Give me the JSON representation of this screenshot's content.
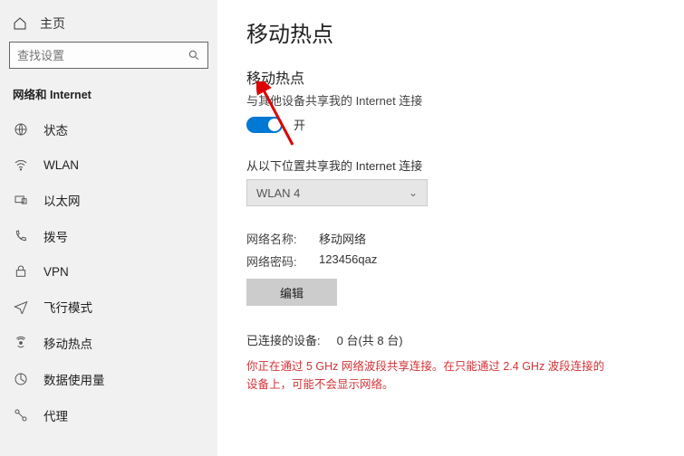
{
  "sidebar": {
    "home_label": "主页",
    "search_placeholder": "查找设置",
    "section_title": "网络和 Internet",
    "items": [
      {
        "label": "状态",
        "icon": "status"
      },
      {
        "label": "WLAN",
        "icon": "wifi"
      },
      {
        "label": "以太网",
        "icon": "ethernet"
      },
      {
        "label": "拨号",
        "icon": "dialup"
      },
      {
        "label": "VPN",
        "icon": "vpn"
      },
      {
        "label": "飞行模式",
        "icon": "airplane"
      },
      {
        "label": "移动热点",
        "icon": "hotspot"
      },
      {
        "label": "数据使用量",
        "icon": "datausage"
      },
      {
        "label": "代理",
        "icon": "proxy"
      }
    ]
  },
  "page": {
    "title": "移动热点",
    "section_title": "移动热点",
    "share_desc": "与其他设备共享我的 Internet 连接",
    "toggle_state_label": "开",
    "toggle_on": true,
    "share_from_label": "从以下位置共享我的 Internet 连接",
    "dropdown_value": "WLAN 4",
    "net_name_label": "网络名称:",
    "net_name_value": "移动网络",
    "net_pass_label": "网络密码:",
    "net_pass_value": "123456qaz",
    "edit_button": "编辑",
    "connected_label": "已连接的设备:",
    "connected_value": "0 台(共 8 台)",
    "warning": "你正在通过 5 GHz 网络波段共享连接。在只能通过 2.4 GHz 波段连接的设备上，可能不会显示网络。"
  }
}
